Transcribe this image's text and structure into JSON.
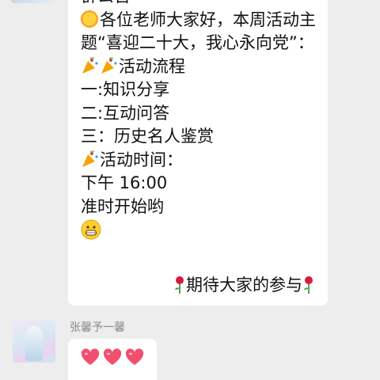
{
  "chat": {
    "announcement": {
      "title_partial": "群公告",
      "lines": [
        "各位老师大家好，本周活动主题“喜迎二十大，我心永向党”：",
        "活动流程",
        "一:知识分享",
        "二:互动问答",
        "三：历史名人鉴赏",
        "活动时间：",
        "下午 16:00",
        "准时开始哟"
      ],
      "closing": "期待大家的参与",
      "icons": {
        "sun": "sun-emoji-icon",
        "party": "party-popper-icon",
        "grin": "grinning-face-icon",
        "rose": "rose-icon"
      }
    },
    "second_message": {
      "sender": "张馨予一馨",
      "content_icons": [
        "heart-icon",
        "heart-icon",
        "heart-icon"
      ]
    },
    "colors": {
      "background": "#ededed",
      "bubble": "#ffffff",
      "heart": "#f0506e"
    }
  }
}
